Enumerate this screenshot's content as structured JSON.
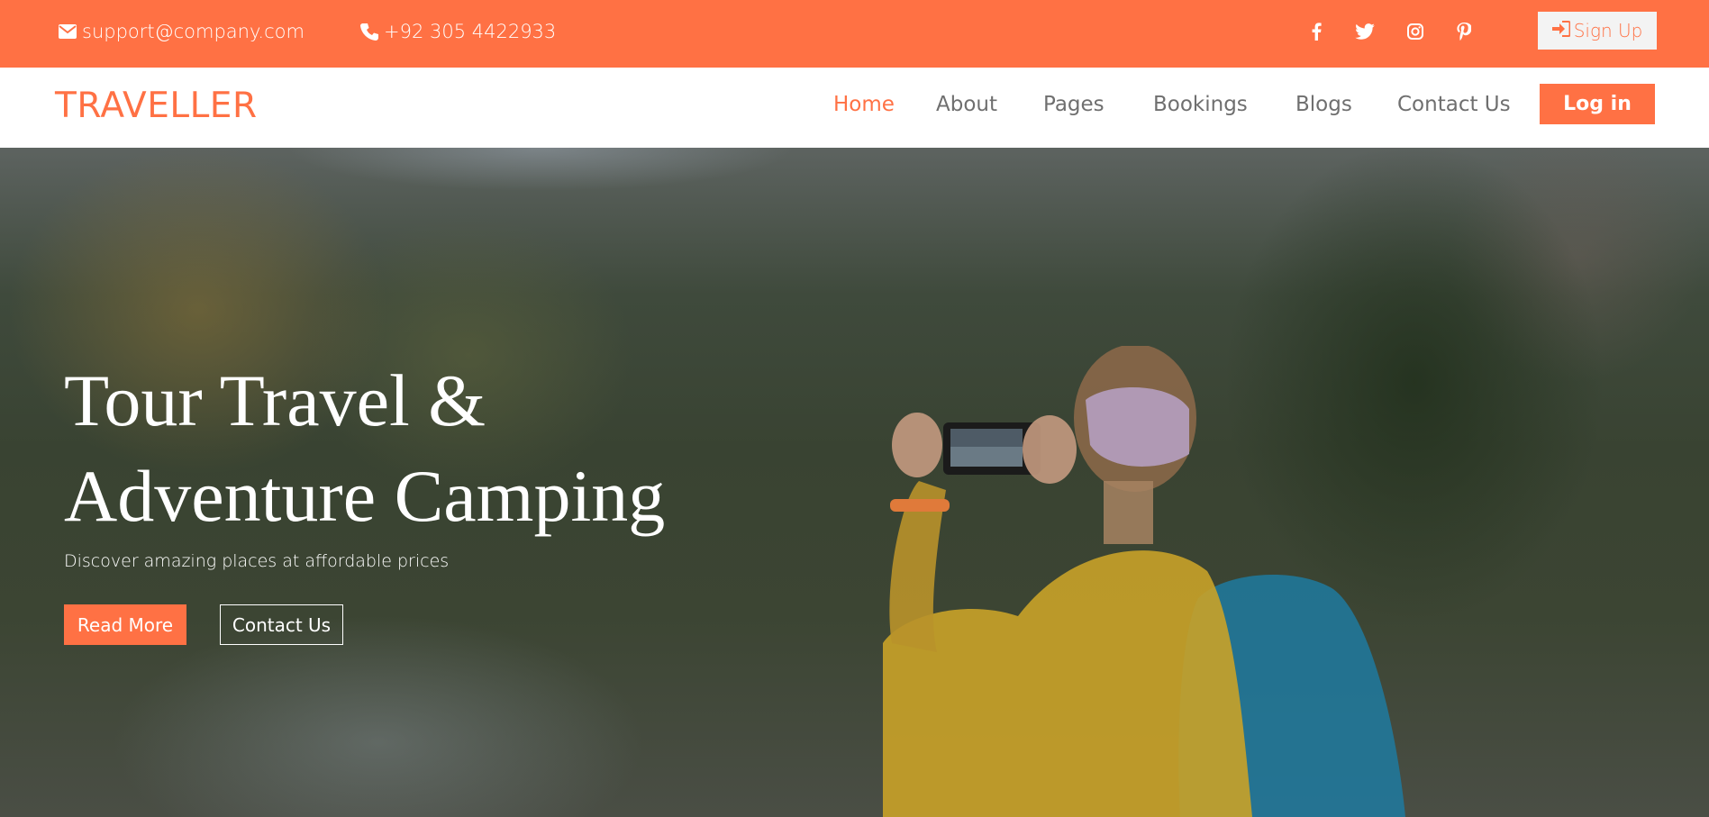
{
  "topbar": {
    "email": "support@company.com",
    "phone": "+92 305 4422933",
    "email_icon": "envelope-icon",
    "phone_icon": "phone-icon",
    "social": [
      "facebook-icon",
      "twitter-icon",
      "instagram-icon",
      "pinterest-icon"
    ],
    "signup_label": "Sign Up",
    "signup_icon": "sign-in-icon",
    "accent_color": "#ff7144"
  },
  "navbar": {
    "logo": "TRAVELLER",
    "links": [
      {
        "label": "Home",
        "active": true
      },
      {
        "label": "About",
        "active": false
      },
      {
        "label": "Pages",
        "active": false
      },
      {
        "label": "Bookings",
        "active": false
      },
      {
        "label": "Blogs",
        "active": false
      },
      {
        "label": "Contact Us",
        "active": false
      }
    ],
    "login_label": "Log in"
  },
  "hero": {
    "title_line1": "Tour Travel &",
    "title_line2": "Adventure Camping",
    "subtitle": "Discover amazing places at affordable prices",
    "read_more_label": "Read More",
    "contact_label": "Contact Us"
  }
}
